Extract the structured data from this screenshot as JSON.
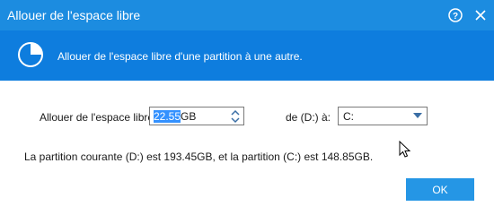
{
  "window": {
    "title": "Allouer de l'espace libre"
  },
  "titlebar_buttons": {
    "help_icon": "question-circle-icon",
    "close_icon": "close-icon"
  },
  "banner": {
    "icon": "pie-chart-icon",
    "text": "Allouer de l'espace libre d'une partition à une autre."
  },
  "form": {
    "alloc_label": "Allouer de l'espace libre:",
    "alloc_value_selected": "22.55",
    "alloc_unit": "GB",
    "target_label": "de (D:) à:",
    "target_value": "C:"
  },
  "info": {
    "text": "La partition courante (D:) est 193.45GB, et la partition (C:) est 148.85GB."
  },
  "buttons": {
    "ok_label": "OK"
  },
  "colors": {
    "titlebar": "#1c8ce0",
    "banner": "#0e7dde",
    "ok_button": "#2596e5",
    "selection": "#3391ff"
  }
}
